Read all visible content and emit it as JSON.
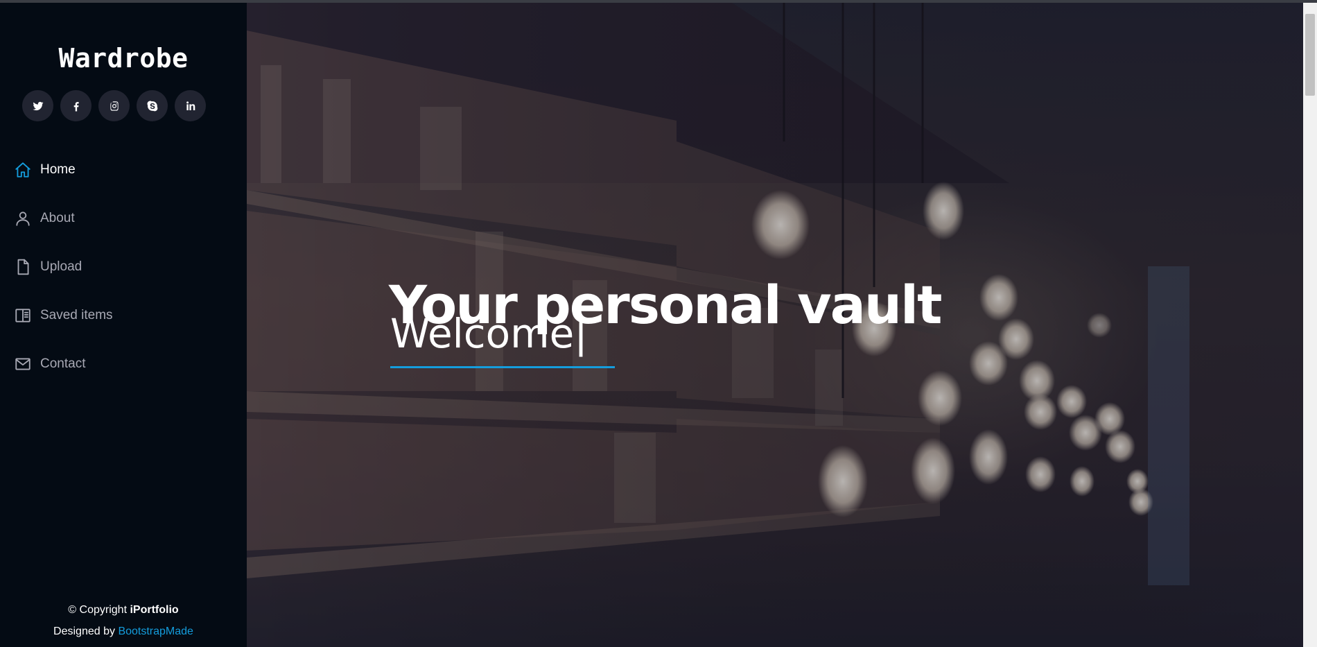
{
  "sidebar": {
    "logo": "Wardrobe",
    "socials": [
      {
        "icon": "twitter-icon"
      },
      {
        "icon": "facebook-icon"
      },
      {
        "icon": "instagram-icon"
      },
      {
        "icon": "skype-icon"
      },
      {
        "icon": "linkedin-icon"
      }
    ],
    "nav": [
      {
        "label": "Home",
        "icon": "home-icon",
        "active": true
      },
      {
        "label": "About",
        "icon": "person-icon",
        "active": false
      },
      {
        "label": "Upload",
        "icon": "file-icon",
        "active": false
      },
      {
        "label": "Saved items",
        "icon": "book-icon",
        "active": false
      },
      {
        "label": "Contact",
        "icon": "envelope-icon",
        "active": false
      }
    ],
    "footer": {
      "copyright_prefix": "© Copyright",
      "copyright_brand": "iPortfolio",
      "designed_prefix": "Designed by",
      "designed_link": "BootstrapMade"
    }
  },
  "hero": {
    "title": "Your personal vault",
    "subtitle": "Welcome|"
  },
  "colors": {
    "sidebar_bg": "#040b14",
    "accent": "#149ddd",
    "social_bg": "#212431",
    "nav_text": "#a8a9b4"
  }
}
